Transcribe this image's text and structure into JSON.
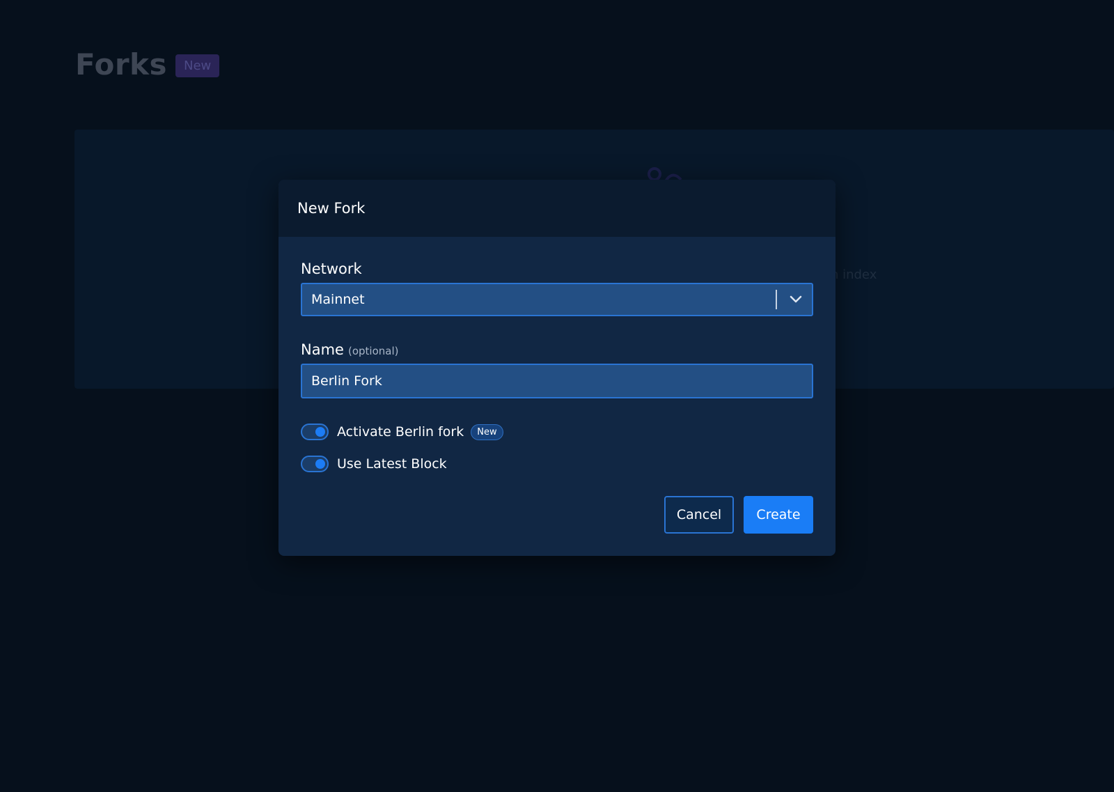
{
  "page": {
    "title": "Forks",
    "title_badge": "New",
    "background_hint": "ction index"
  },
  "modal": {
    "title": "New Fork",
    "network": {
      "label": "Network",
      "selected": "Mainnet"
    },
    "name": {
      "label": "Name",
      "hint": "(optional)",
      "value": "Berlin Fork"
    },
    "toggles": [
      {
        "label": "Activate Berlin fork",
        "badge": "New",
        "enabled": true
      },
      {
        "label": "Use Latest Block",
        "enabled": true
      }
    ],
    "buttons": {
      "cancel": "Cancel",
      "create": "Create"
    }
  },
  "colors": {
    "background": "#06101c",
    "modal": "#112744",
    "accent": "#1a7df6"
  }
}
